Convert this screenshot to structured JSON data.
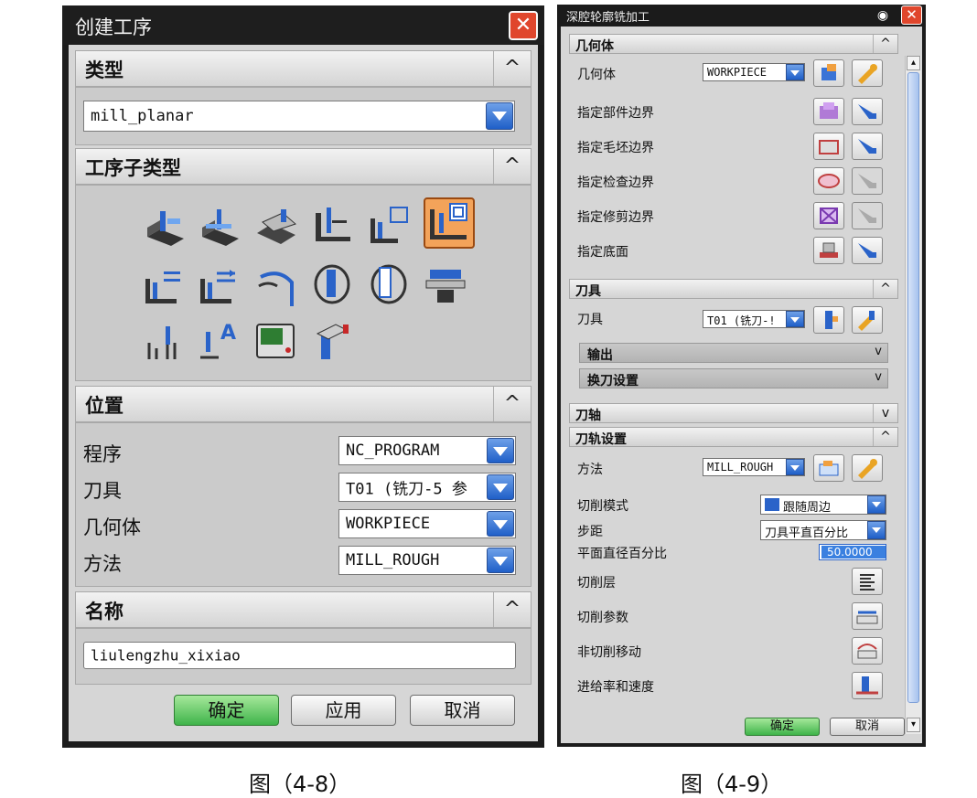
{
  "left_dialog": {
    "title": "创建工序",
    "close": "✕",
    "type_section": {
      "label": "类型",
      "value": "mill_planar"
    },
    "subtype_section": {
      "label": "工序子类型"
    },
    "location_section": {
      "label": "位置",
      "rows": [
        {
          "label": "程序",
          "value": "NC_PROGRAM"
        },
        {
          "label": "刀具",
          "value": "T01 (铣刀-5 参"
        },
        {
          "label": "几何体",
          "value": "WORKPIECE"
        },
        {
          "label": "方法",
          "value": "MILL_ROUGH"
        }
      ]
    },
    "name_section": {
      "label": "名称",
      "value": "liulengzhu_xixiao"
    },
    "buttons": {
      "ok": "确定",
      "apply": "应用",
      "cancel": "取消"
    },
    "chevron": "^"
  },
  "right_dialog": {
    "title": "深腔轮廓铣加工",
    "close": "✕",
    "eye": "◉",
    "chevron_up": "^",
    "chevron_down": "v",
    "geometry_section": {
      "label": "几何体",
      "geometry_label": "几何体",
      "geometry_value": "WORKPIECE",
      "rows": [
        "指定部件边界",
        "指定毛坯边界",
        "指定检查边界",
        "指定修剪边界",
        "指定底面"
      ]
    },
    "tool_section": {
      "label": "刀具",
      "tool_label": "刀具",
      "tool_value": "T01 (铣刀-!",
      "sub_output": "输出",
      "sub_change": "换刀设置"
    },
    "axis_section": {
      "label": "刀轴"
    },
    "path_section": {
      "label": "刀轨设置",
      "method_label": "方法",
      "method_value": "MILL_ROUGH",
      "cut_mode_label": "切削模式",
      "cut_mode_value": "跟随周边",
      "step_label": "步距",
      "step_value": "刀具平直百分比",
      "percent_label": "平面直径百分比",
      "percent_value": "50.0000",
      "rows": [
        "切削层",
        "切削参数",
        "非切削移动",
        "进给率和速度"
      ]
    },
    "buttons": {
      "ok": "确定",
      "cancel": "取消"
    }
  },
  "captions": {
    "left": "图（4-8）",
    "right": "图（4-9）"
  },
  "colors": {
    "accent_blue": "#1f5fc8",
    "ok_green": "#3fb44a",
    "close_red": "#e0462c",
    "selected_orange": "#f3a35a"
  }
}
